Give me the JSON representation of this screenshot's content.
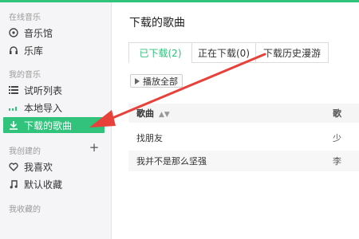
{
  "sidebar": {
    "online_music_title": "在线音乐",
    "online_items": [
      {
        "label": "音乐馆",
        "icon": "disc-icon"
      },
      {
        "label": "乐库",
        "icon": "headphones-icon"
      }
    ],
    "my_music_title": "我的音乐",
    "my_items": [
      {
        "label": "试听列表",
        "icon": "list-icon"
      },
      {
        "label": "本地导入",
        "icon": "equalizer-icon"
      },
      {
        "label": "下载的歌曲",
        "icon": "download-icon"
      }
    ],
    "created_title": "我创建的",
    "created_items": [
      {
        "label": "我喜欢",
        "icon": "heart-icon"
      },
      {
        "label": "默认收藏",
        "icon": "music-note-icon"
      }
    ],
    "collected_title": "我收藏的"
  },
  "main": {
    "title": "下载的歌曲",
    "tabs": [
      "已下载(2)",
      "正在下载(0)",
      "下载历史漫游"
    ],
    "play_all": "播放全部",
    "columns": [
      "歌曲",
      "歌"
    ],
    "rows": [
      {
        "song": "找朋友",
        "artist": "少"
      },
      {
        "song": "我并不是那么坚强",
        "artist": "李"
      }
    ]
  },
  "colors": {
    "accent": "#31c27c",
    "annotation_arrow": "#e8413a"
  }
}
